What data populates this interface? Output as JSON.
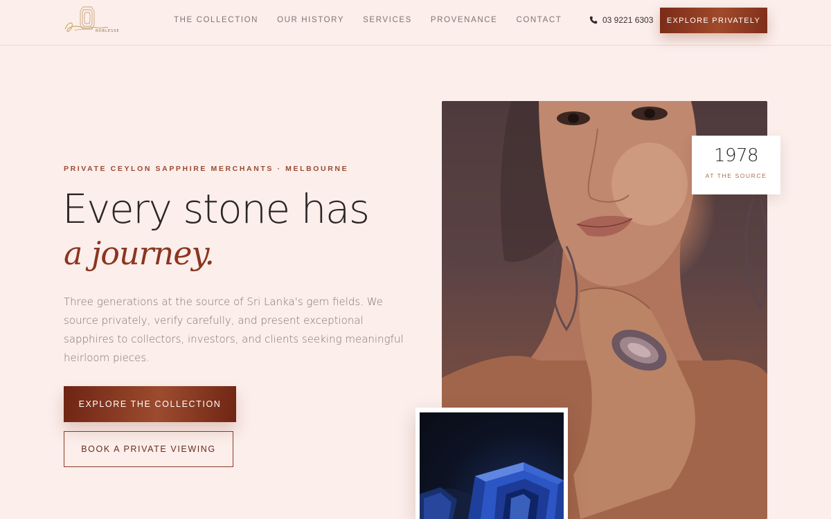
{
  "brand": {
    "name": "Sapphire Noblesse",
    "logo_sub": "NOBLESSE"
  },
  "nav": {
    "items": [
      {
        "label": "THE COLLECTION"
      },
      {
        "label": "OUR HISTORY"
      },
      {
        "label": "SERVICES"
      },
      {
        "label": "PROVENANCE"
      },
      {
        "label": "CONTACT"
      }
    ],
    "phone": "03 9221 6303",
    "phone_icon": "phone-icon",
    "cta_label": "EXPLORE PRIVATELY"
  },
  "hero": {
    "eyebrow": "PRIVATE CEYLON SAPPHIRE MERCHANTS · MELBOURNE",
    "headline": "Every stone has",
    "headline_script": "a journey.",
    "intro": "Three generations at the source of Sri Lanka's gem fields. We source privately, verify carefully, and present exceptional sapphires to collectors, investors, and clients seeking meaningful heirloom pieces.",
    "primary_cta": "EXPLORE THE COLLECTION",
    "secondary_cta": "BOOK A PRIVATE VIEWING"
  },
  "badge": {
    "year": "1978",
    "label": "AT THE SOURCE"
  },
  "colors": {
    "background": "#fbeeeb",
    "accent": "#8b3520",
    "accent_dark": "#6e2413",
    "eyebrow": "#9a4a32",
    "body_text": "#7e7470"
  }
}
